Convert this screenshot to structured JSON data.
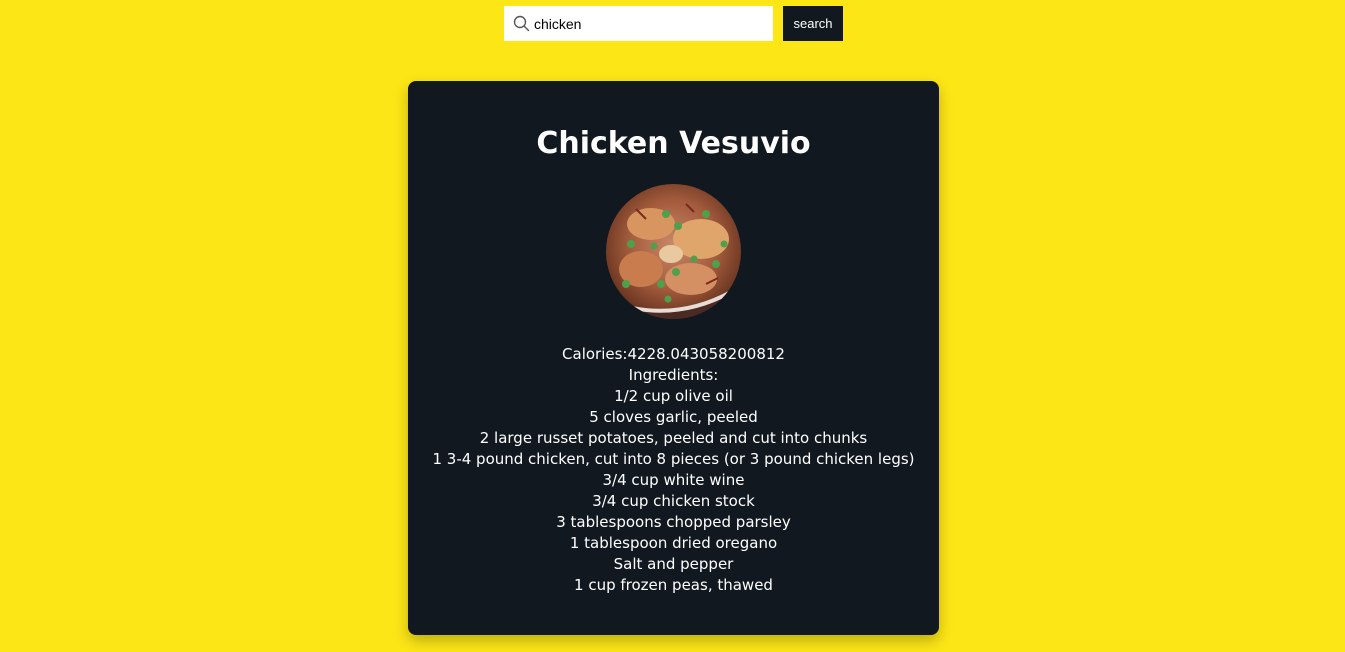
{
  "search": {
    "value": "chicken",
    "placeholder": "",
    "icon": "search-icon",
    "button_label": "search"
  },
  "recipe": {
    "title": "Chicken Vesuvio",
    "image_icon": "food-photo",
    "calories_label": "Calories:",
    "calories_value": "4228.043058200812",
    "ingredients_label": "Ingredients:",
    "ingredients": [
      "1/2 cup olive oil",
      "5 cloves garlic, peeled",
      "2 large russet potatoes, peeled and cut into chunks",
      "1 3-4 pound chicken, cut into 8 pieces (or 3 pound chicken legs)",
      "3/4 cup white wine",
      "3/4 cup chicken stock",
      "3 tablespoons chopped parsley",
      "1 tablespoon dried oregano",
      "Salt and pepper",
      "1 cup frozen peas, thawed"
    ]
  },
  "colors": {
    "background": "#fde616",
    "card": "#111820",
    "button": "#111820",
    "text_light": "#ffffff"
  }
}
